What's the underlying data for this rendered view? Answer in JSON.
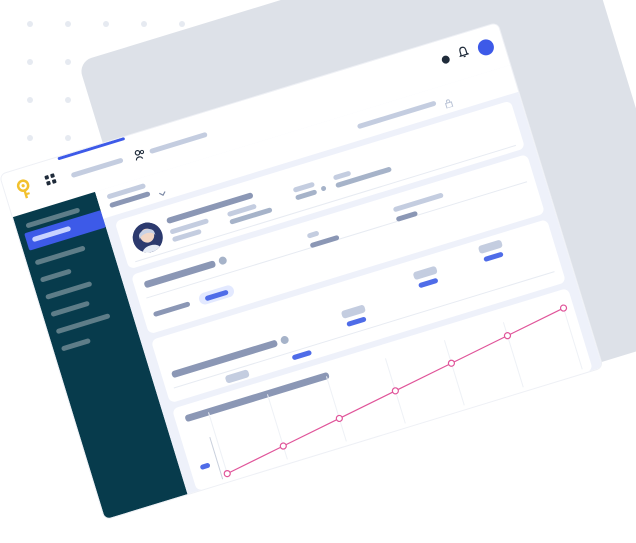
{
  "topbar": {
    "tabs": [
      {
        "label": "",
        "active": true
      },
      {
        "label": "",
        "active": false
      }
    ],
    "accent": "#3d5ae8"
  },
  "sidebar": {
    "bg": "#073b4c",
    "items": [
      {
        "label": "",
        "active": false
      },
      {
        "label": "",
        "active": true
      },
      {
        "label": "",
        "active": false
      },
      {
        "label": "",
        "active": false
      },
      {
        "label": "",
        "active": false
      },
      {
        "label": "",
        "active": false
      },
      {
        "label": "",
        "active": false
      },
      {
        "label": "",
        "active": false
      }
    ]
  },
  "profile": {
    "name": "",
    "subtitle": ""
  },
  "chart_data": {
    "type": "line",
    "x": [
      1,
      2,
      3,
      4,
      5,
      6,
      7
    ],
    "series": [
      {
        "values": [
          1,
          2,
          3,
          4,
          5,
          6,
          7
        ]
      }
    ],
    "line_color": "#e0559a"
  }
}
